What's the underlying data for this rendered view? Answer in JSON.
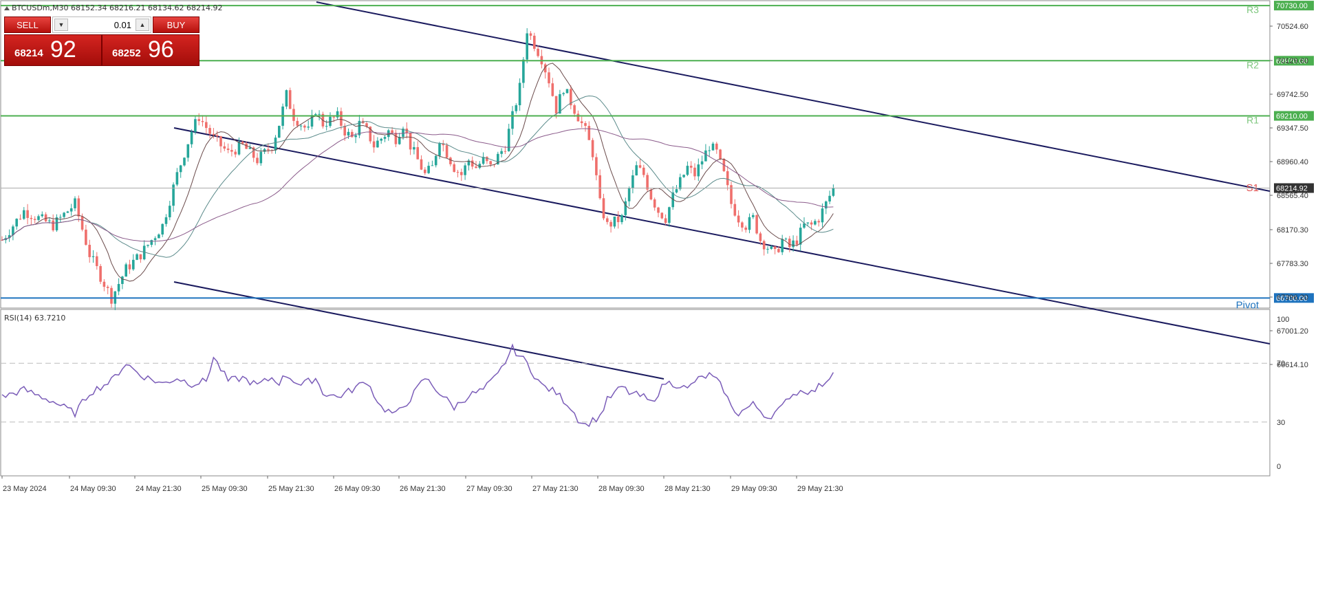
{
  "symbol_info": "BTCUSDm,M30  68152.34 68216.21 68134.62 68214.92",
  "trade_panel": {
    "sell_label": "SELL",
    "buy_label": "BUY",
    "lot_value": "0.01",
    "bid_main": "68214",
    "bid_big": "92",
    "ask_main": "68252",
    "ask_big": "96"
  },
  "levels": {
    "r3": {
      "label": "R3",
      "value": "70730.00",
      "price": 70730,
      "color": "#4caf50"
    },
    "r2": {
      "label": "R2",
      "value": "69970.00",
      "price": 69970,
      "color": "#4caf50"
    },
    "r1": {
      "label": "R1",
      "value": "69210.00",
      "price": 69210,
      "color": "#4caf50"
    },
    "s1": {
      "label": "S1",
      "color": "#e05050"
    },
    "pivot": {
      "label": "Pivot",
      "value": "66700.00",
      "price": 66700,
      "color": "#1e73be"
    },
    "current": {
      "value": "68214.92",
      "price": 68214.92
    }
  },
  "price_axis": [
    "70524.60",
    "70129.60",
    "69742.50",
    "69347.50",
    "68960.40",
    "68565.40",
    "68170.30",
    "67783.30",
    "67396.20",
    "67001.20",
    "66614.10"
  ],
  "rsi": {
    "label": "RSI(14) 63.7210",
    "levels": [
      "100",
      "70",
      "30",
      "0"
    ],
    "line_color": "#7a5cb8"
  },
  "time_axis": [
    "23 May 2024",
    "24 May 09:30",
    "24 May 21:30",
    "25 May 09:30",
    "25 May 21:30",
    "26 May 09:30",
    "26 May 21:30",
    "27 May 09:30",
    "27 May 21:30",
    "28 May 09:30",
    "28 May 21:30",
    "29 May 09:30",
    "29 May 21:30"
  ],
  "colors": {
    "bull": "#26a69a",
    "bear": "#ef6f6c",
    "channel": "#1a1a5e",
    "ma1": "#6a4a4a",
    "ma2": "#5a8a8a",
    "ma3": "#8a5a8a"
  },
  "chart_data": {
    "type": "candlestick",
    "xlabel": "",
    "ylabel": "",
    "ylim": [
      66580,
      70750
    ],
    "close_path": [
      [
        0,
        67500
      ],
      [
        6,
        67900
      ],
      [
        14,
        67700
      ],
      [
        20,
        68000
      ],
      [
        24,
        67300
      ],
      [
        30,
        66700
      ],
      [
        34,
        67100
      ],
      [
        38,
        67300
      ],
      [
        44,
        67700
      ],
      [
        48,
        68400
      ],
      [
        52,
        69000
      ],
      [
        54,
        69200
      ],
      [
        58,
        68900
      ],
      [
        62,
        68700
      ],
      [
        66,
        68800
      ],
      [
        70,
        68600
      ],
      [
        74,
        68800
      ],
      [
        76,
        69100
      ],
      [
        78,
        69500
      ],
      [
        80,
        69200
      ],
      [
        84,
        69000
      ],
      [
        86,
        69300
      ],
      [
        88,
        69100
      ],
      [
        92,
        69200
      ],
      [
        94,
        69000
      ],
      [
        96,
        68900
      ],
      [
        98,
        69100
      ],
      [
        100,
        69000
      ],
      [
        102,
        68800
      ],
      [
        104,
        68900
      ],
      [
        106,
        69000
      ],
      [
        108,
        68900
      ],
      [
        110,
        69100
      ],
      [
        112,
        68800
      ],
      [
        114,
        68600
      ],
      [
        116,
        68400
      ],
      [
        118,
        68500
      ],
      [
        120,
        68900
      ],
      [
        122,
        68700
      ],
      [
        124,
        68500
      ],
      [
        126,
        68400
      ],
      [
        128,
        68600
      ],
      [
        130,
        68500
      ],
      [
        132,
        68600
      ],
      [
        134,
        68500
      ],
      [
        138,
        68800
      ],
      [
        142,
        69600
      ],
      [
        144,
        70400
      ],
      [
        146,
        70200
      ],
      [
        148,
        70000
      ],
      [
        150,
        69700
      ],
      [
        152,
        69300
      ],
      [
        154,
        69600
      ],
      [
        156,
        69400
      ],
      [
        158,
        69200
      ],
      [
        160,
        69000
      ],
      [
        162,
        68700
      ],
      [
        164,
        68000
      ],
      [
        166,
        67700
      ],
      [
        170,
        67800
      ],
      [
        172,
        68200
      ],
      [
        174,
        68500
      ],
      [
        176,
        68400
      ],
      [
        178,
        68100
      ],
      [
        180,
        67900
      ],
      [
        182,
        67800
      ],
      [
        184,
        68100
      ],
      [
        186,
        68300
      ],
      [
        188,
        68500
      ],
      [
        190,
        68400
      ],
      [
        192,
        68600
      ],
      [
        194,
        68800
      ],
      [
        196,
        68700
      ],
      [
        198,
        68400
      ],
      [
        200,
        68000
      ],
      [
        202,
        67800
      ],
      [
        204,
        67700
      ],
      [
        206,
        67800
      ],
      [
        208,
        67500
      ],
      [
        210,
        67400
      ],
      [
        212,
        67300
      ],
      [
        214,
        67500
      ],
      [
        216,
        67400
      ],
      [
        218,
        67500
      ],
      [
        220,
        67700
      ],
      [
        222,
        67700
      ],
      [
        224,
        67800
      ],
      [
        226,
        68000
      ],
      [
        228,
        68214
      ]
    ],
    "rsi_path": [
      [
        0,
        47
      ],
      [
        6,
        52
      ],
      [
        14,
        44
      ],
      [
        20,
        36
      ],
      [
        24,
        50
      ],
      [
        30,
        58
      ],
      [
        34,
        70
      ],
      [
        38,
        62
      ],
      [
        44,
        56
      ],
      [
        48,
        60
      ],
      [
        52,
        56
      ],
      [
        56,
        58
      ],
      [
        58,
        74
      ],
      [
        62,
        58
      ],
      [
        66,
        60
      ],
      [
        70,
        55
      ],
      [
        74,
        60
      ],
      [
        76,
        57
      ],
      [
        78,
        62
      ],
      [
        82,
        55
      ],
      [
        86,
        60
      ],
      [
        88,
        50
      ],
      [
        92,
        47
      ],
      [
        96,
        52
      ],
      [
        100,
        58
      ],
      [
        104,
        40
      ],
      [
        108,
        35
      ],
      [
        112,
        46
      ],
      [
        116,
        60
      ],
      [
        120,
        50
      ],
      [
        124,
        40
      ],
      [
        128,
        48
      ],
      [
        132,
        52
      ],
      [
        136,
        62
      ],
      [
        140,
        80
      ],
      [
        144,
        70
      ],
      [
        146,
        62
      ],
      [
        148,
        55
      ],
      [
        152,
        50
      ],
      [
        156,
        40
      ],
      [
        158,
        32
      ],
      [
        160,
        28
      ],
      [
        164,
        34
      ],
      [
        166,
        45
      ],
      [
        170,
        54
      ],
      [
        172,
        50
      ],
      [
        176,
        47
      ],
      [
        178,
        43
      ],
      [
        182,
        57
      ],
      [
        186,
        55
      ],
      [
        188,
        52
      ],
      [
        190,
        58
      ],
      [
        194,
        62
      ],
      [
        196,
        58
      ],
      [
        198,
        52
      ],
      [
        200,
        40
      ],
      [
        202,
        36
      ],
      [
        206,
        42
      ],
      [
        208,
        38
      ],
      [
        210,
        33
      ],
      [
        214,
        40
      ],
      [
        216,
        48
      ],
      [
        220,
        52
      ],
      [
        222,
        50
      ],
      [
        226,
        58
      ],
      [
        228,
        63.7
      ]
    ]
  }
}
